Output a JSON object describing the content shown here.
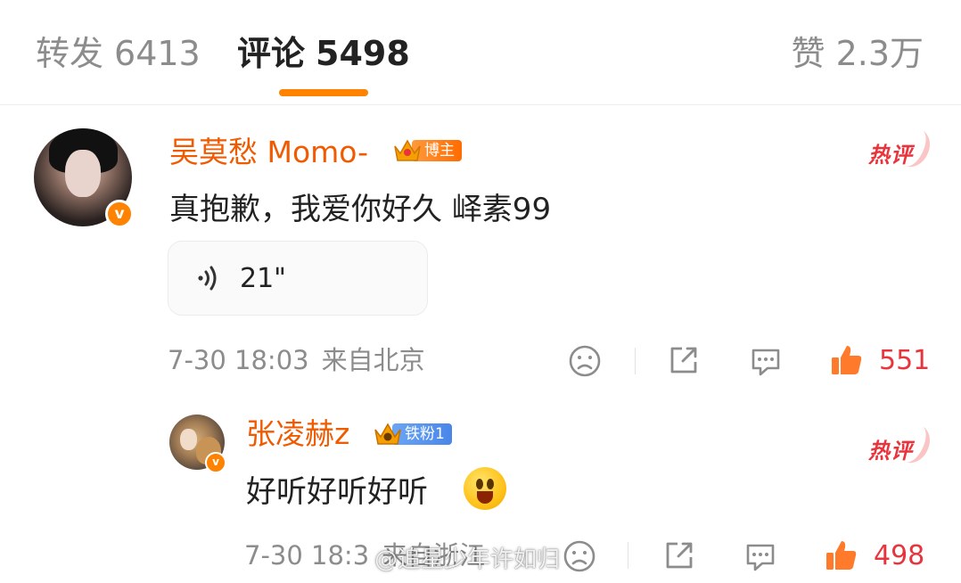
{
  "tabs": {
    "repost": {
      "label": "转发",
      "count": "6413"
    },
    "comments": {
      "label": "评论",
      "count": "5498"
    },
    "likes": {
      "label": "赞",
      "count": "2.3万"
    },
    "active": "comments",
    "accent_color": "#ff8200"
  },
  "comments": [
    {
      "username": "吴莫愁 Momo-",
      "badge": "博主",
      "badge_icon": "crown-icon",
      "verified_icon": "v",
      "tag": "热评",
      "text": "真抱歉，我爱你好久 峄素99",
      "voice": {
        "icon": "sound-wave-icon",
        "duration": "21\""
      },
      "time": "7-30 18:03",
      "location": "来自北京",
      "likes": "551"
    },
    {
      "username": "张凌赫z",
      "badge": "铁粉1",
      "badge_icon": "crown-icon",
      "verified_icon": "v",
      "tag": "热评",
      "text": "好听好听好听",
      "emoji": "surprised-emoji",
      "time": "7-30 18:3",
      "location": "来自浙江",
      "likes": "498"
    }
  ],
  "watermark": "@追星少年许如归",
  "colors": {
    "username": "#f05a00",
    "like": "#e8343c",
    "meta": "#8c8c8c"
  }
}
